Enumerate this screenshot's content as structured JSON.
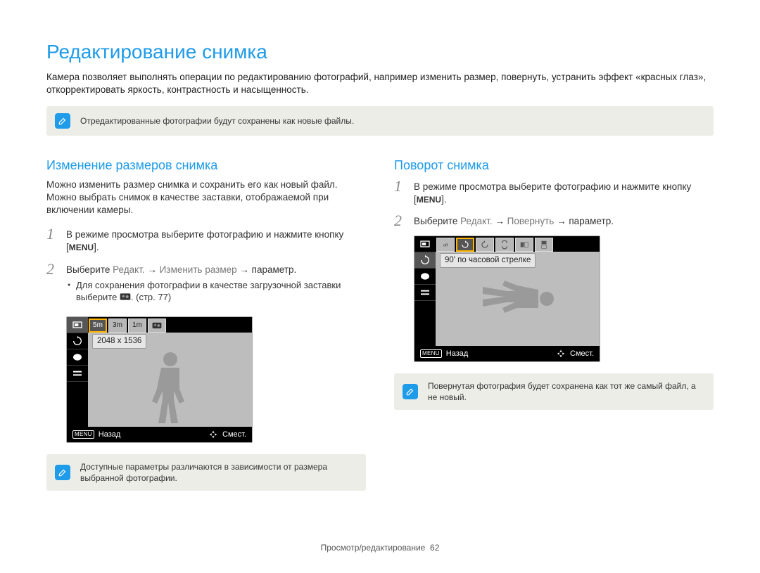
{
  "title": "Редактирование снимка",
  "intro": "Камера позволяет выполнять операции по редактированию фотографий, например изменить размер, повернуть, устранить эффект «красных глаз», откорректировать яркость, контрастность и насыщенность.",
  "top_note": "Отредактированные фотографии будут сохранены как новые файлы.",
  "left": {
    "heading": "Изменение размеров снимка",
    "desc": "Можно изменить размер снимка и сохранить его как новый файл. Можно выбрать снимок в качестве заставки, отображаемой при включении камеры.",
    "step1_a": "В режиме просмотра выберите фотографию и нажмите кнопку [",
    "step1_btn": "MENU",
    "step1_b": "].",
    "step2_a": "Выберите ",
    "step2_m1": "Редакт.",
    "step2_arrow1": " → ",
    "step2_m2": "Изменить размер",
    "step2_arrow2": " → параметр.",
    "bullet1_a": "Для сохранения фотографии в качестве загрузочной заставки выберите ",
    "bullet1_b": ". (стр. 77)",
    "lcd": {
      "top_tiles": [
        "5m",
        "3m",
        "1m"
      ],
      "status": "2048 х 1536",
      "back_label": "Назад",
      "move_label": "Смест.",
      "menu_btn": "MENU"
    },
    "note": "Доступные параметры различаются в зависимости от размера выбранной фотографии."
  },
  "right": {
    "heading": "Поворот снимка",
    "step1_a": "В режиме просмотра выберите фотографию и нажмите кнопку [",
    "step1_btn": "MENU",
    "step1_b": "].",
    "step2_a": "Выберите ",
    "step2_m1": "Редакт.",
    "step2_arrow1": " → ",
    "step2_m2": "Повернуть",
    "step2_arrow2": " → параметр.",
    "lcd": {
      "status": "90' по часовой стрелке",
      "back_label": "Назад",
      "move_label": "Смест.",
      "menu_btn": "MENU"
    },
    "note": "Повернутая фотография будет сохранена как тот же самый файл, а не новый."
  },
  "footer_a": "Просмотр/редактирование",
  "footer_b": "62"
}
